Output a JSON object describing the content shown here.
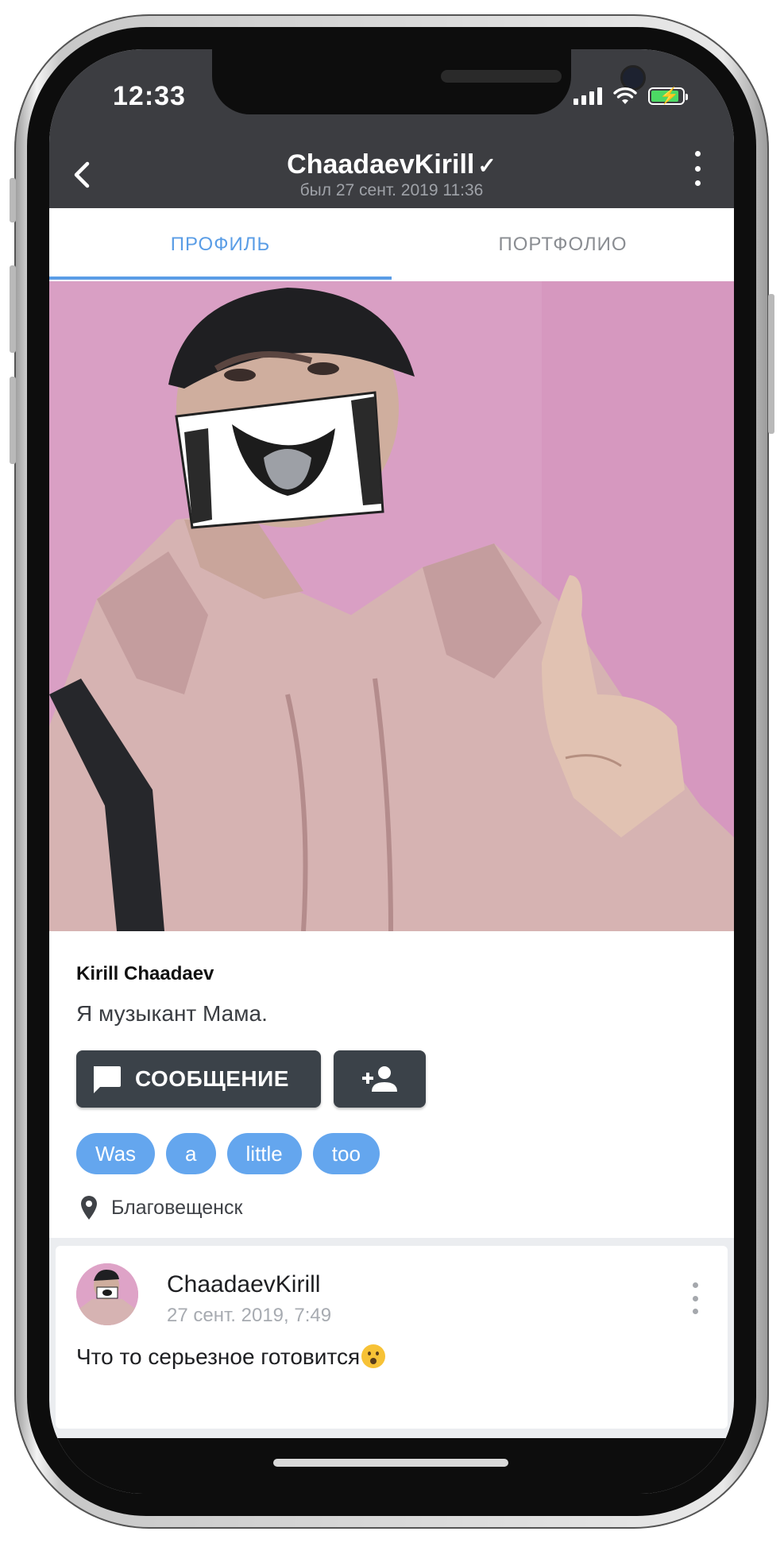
{
  "status_bar": {
    "time": "12:33",
    "battery_fill": 0.85,
    "battery_charging": true
  },
  "header": {
    "title": "ChaadaevKirill",
    "verified_mark": "✓",
    "subtitle": "был 27 сент. 2019 11:36",
    "back_icon": "chevron-left-icon",
    "more_icon": "more-vertical-icon"
  },
  "tabs": [
    {
      "label": "ПРОФИЛЬ",
      "active": true
    },
    {
      "label": "ПОРТФОЛИО",
      "active": false
    }
  ],
  "profile": {
    "name": "Kirill Chaadaev",
    "bio": "Я музыкант Мама.",
    "message_button": "СООБЩЕНИЕ",
    "message_icon": "chat-bubble-icon",
    "add_friend_icon": "person-add-icon",
    "tags": [
      "Was",
      "a",
      "little",
      "too"
    ],
    "location": "Благовещенск",
    "location_icon": "map-pin-icon"
  },
  "post": {
    "author": "ChaadaevKirill",
    "date": "27 сент. 2019, 7:49",
    "text": "Что то серьезное готовится",
    "emoji": "hushed-face-emoji"
  },
  "colors": {
    "header_bg": "#3c3d41",
    "accent": "#5a9de6",
    "tag_bg": "#64a6ee",
    "button_bg": "#3b4249",
    "photo_bg": "#d99fc4"
  }
}
